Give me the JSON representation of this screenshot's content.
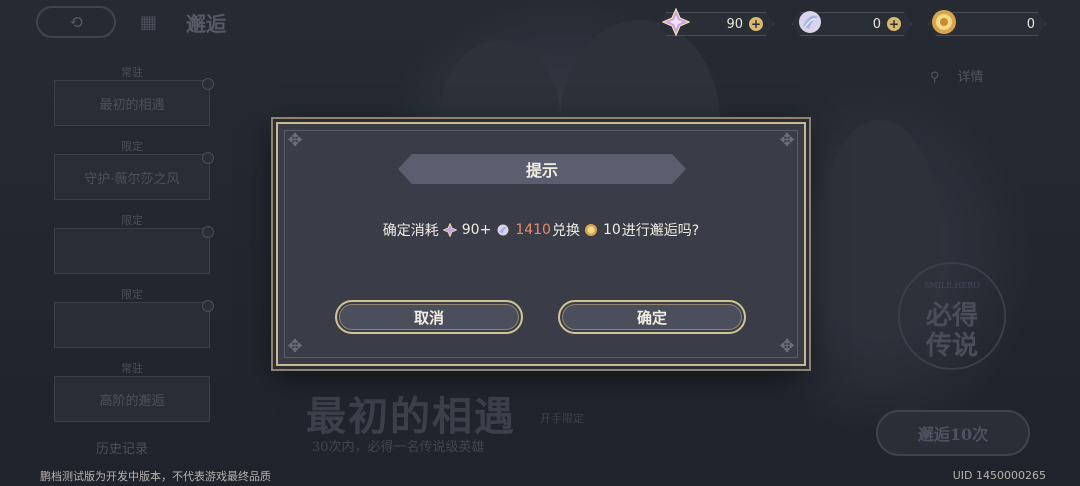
{
  "header": {
    "back_icon": "back-arrow-icon",
    "page_title": "邂逅"
  },
  "currencies": [
    {
      "name": "star-crystal",
      "value": "90",
      "has_plus": true
    },
    {
      "name": "feather-token",
      "value": "0",
      "has_plus": true
    },
    {
      "name": "summon-coin",
      "value": "0",
      "has_plus": false
    }
  ],
  "sidebar": {
    "items": [
      {
        "caption": "常驻",
        "label": "最初的相遇"
      },
      {
        "caption": "限定",
        "label": "守护·薇尔莎之风"
      },
      {
        "caption": "限定",
        "label": ""
      },
      {
        "caption": "限定",
        "label": ""
      },
      {
        "caption": "常驻",
        "label": "高阶的邂逅"
      }
    ],
    "history": "历史记录"
  },
  "banner": {
    "detail": "详情",
    "title": "最初的相遇",
    "subtitle": "开手限定",
    "note": "30次内，必得一名传说级英雄",
    "seal_top": "SMILE.HERO",
    "seal_line1": "必得",
    "seal_line2": "传说",
    "summon10": "邂逅10次"
  },
  "dialog": {
    "title": "提示",
    "msg_prefix": "确定消耗",
    "cost_crystal": "90+",
    "cost_feather": "1410",
    "msg_mid": "兑换",
    "gain_coin": "10",
    "msg_suffix": "进行邂逅吗?",
    "cancel": "取消",
    "confirm": "确定"
  },
  "footer": {
    "notice": "鹏档测试版为开发中版本，不代表游戏最终品质",
    "uid": "UID 1450000265"
  },
  "colors": {
    "dialog_bg": "#3a3d48",
    "gold_border": "#c8b98e",
    "highlight_red": "#e88a6c"
  }
}
